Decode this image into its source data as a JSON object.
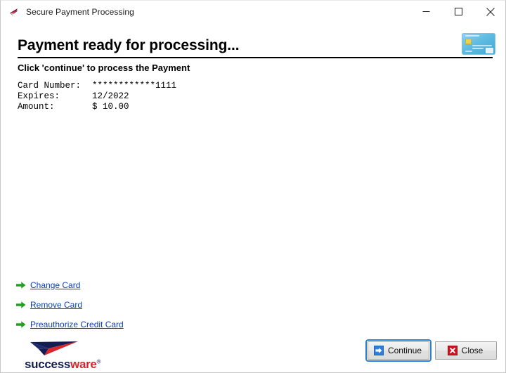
{
  "window": {
    "title": "Secure Payment Processing",
    "icon": "successware-swoosh-icon",
    "controls": {
      "minimize": "minimize-icon",
      "maximize": "maximize-icon",
      "close": "close-icon"
    }
  },
  "header": {
    "title": "Payment ready for processing...",
    "subtitle": "Click 'continue' to process the Payment",
    "card_image": "credit-card-image"
  },
  "details": {
    "rows": [
      {
        "label": "Card Number:",
        "value": "************1111"
      },
      {
        "label": "Expires:",
        "value": "12/2022"
      },
      {
        "label": "Amount:",
        "value": "$ 10.00"
      }
    ]
  },
  "links": [
    {
      "label": "Change Card",
      "icon": "green-arrow-icon"
    },
    {
      "label": "Remove Card",
      "icon": "green-arrow-icon"
    },
    {
      "label": "Preauthorize Credit Card",
      "icon": "green-arrow-icon"
    }
  ],
  "logo": {
    "text_primary": "success",
    "text_secondary": "ware",
    "trademark": "®"
  },
  "footer": {
    "continue_label": "Continue",
    "continue_icon": "blue-arrow-icon",
    "close_label": "Close",
    "close_icon": "red-x-icon"
  },
  "colors": {
    "link": "#0b3fb0",
    "link_arrow": "#22a022",
    "logo_navy": "#141c54",
    "logo_red": "#d8262c",
    "focus_ring": "#2a7fd4",
    "close_icon_red": "#cf1420",
    "continue_icon_blue": "#1e63b4",
    "card_blue": "#5fbbe2"
  }
}
